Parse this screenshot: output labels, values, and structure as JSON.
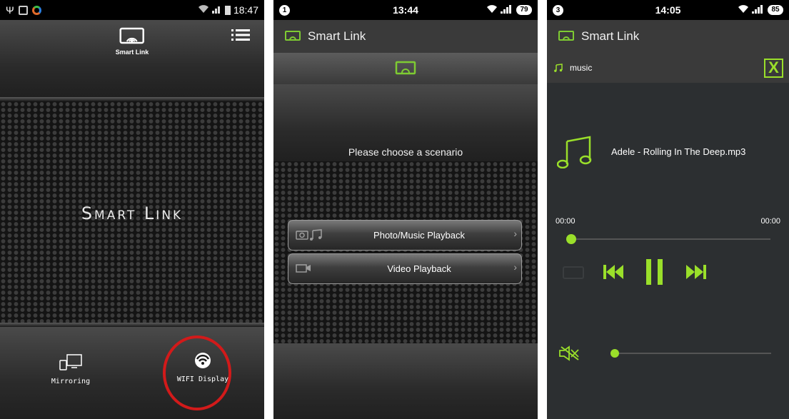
{
  "screen1": {
    "status_time": "18:47",
    "top_icon_label": "Smart Link",
    "brand": "Smart Link",
    "mirroring_label": "Mirroring",
    "wifi_display_label": "WIFI Display"
  },
  "screen2": {
    "status_time": "13:44",
    "notif_count": "1",
    "battery": "79",
    "title": "Smart Link",
    "prompt": "Please choose a scenario",
    "buttons": [
      {
        "label": "Photo/Music Playback"
      },
      {
        "label": "Video Playback"
      }
    ]
  },
  "screen3": {
    "status_time": "14:05",
    "notif_count": "3",
    "battery": "85",
    "title": "Smart Link",
    "section": "music",
    "close_label": "X",
    "track_name": "Adele - Rolling In The Deep.mp3",
    "time_elapsed": "00:00",
    "time_total": "00:00",
    "progress_fraction": 0,
    "volume_fraction": 0
  },
  "colors": {
    "accent_green": "#9adf2a",
    "highlight_ring": "#d21a1a"
  }
}
